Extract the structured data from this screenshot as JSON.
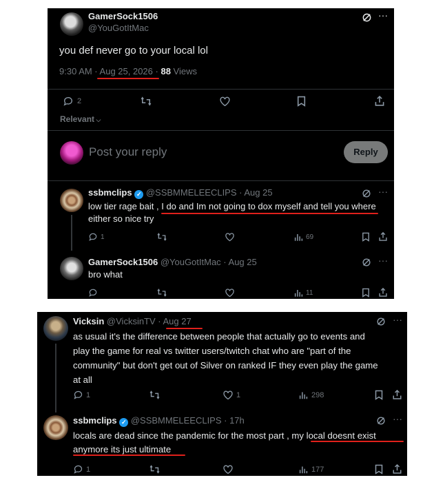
{
  "top": {
    "tweet": {
      "display_name": "GamerSock1506",
      "handle": "@YouGotItMac",
      "text": "you def never go to your local lol",
      "time": "9:30 AM · ",
      "date": "Aug 25, 2026",
      "sep": " · ",
      "views_count": "88",
      "views_label": " Views",
      "replies": "2",
      "relevant": "Relevant"
    },
    "composer": {
      "placeholder": "Post your reply",
      "button": "Reply"
    },
    "reply1": {
      "display_name": "ssbmclips",
      "handle_date": "@SSBMMELEECLIPS · Aug 25",
      "text_line1": "low tier rage bait , I do and Im not going to dox myself and tell you where",
      "text_line2": "either so nice try",
      "replies": "1",
      "views": "69"
    },
    "reply2": {
      "display_name": "GamerSock1506",
      "handle_date": "@YouGotItMac · Aug 25",
      "text": "bro what",
      "views": "11"
    }
  },
  "bottom": {
    "post1": {
      "display_name": "Vicksin",
      "handle": "@VicksinTV · ",
      "date": "Aug 27",
      "lines": [
        "as usual it's the difference between people that actually go to events and",
        "play the game for real vs twitter users/twitch chat who are \"part of the",
        "community\" but don't get out of Silver on ranked IF they even play the game",
        "at all"
      ],
      "replies": "1",
      "likes": "1",
      "views": "298"
    },
    "post2": {
      "display_name": "ssbmclips",
      "handle_date": "@SSBMMELEECLIPS · 17h",
      "line1": "locals are dead since the pandemic for the most part , my local doesnt exist",
      "line2": "anymore its just ultimate",
      "replies": "1",
      "views": "177"
    }
  },
  "colors": {
    "background": "#000000",
    "text": "#e7e9ea",
    "muted": "#71767b",
    "verified": "#1d9bf0",
    "annotation": "#e0201b"
  },
  "icons": [
    "grok-icon",
    "more-icon",
    "reply-icon",
    "retweet-icon",
    "like-icon",
    "bookmark-icon",
    "share-icon",
    "views-icon",
    "verified-badge",
    "chevron-down-icon"
  ]
}
